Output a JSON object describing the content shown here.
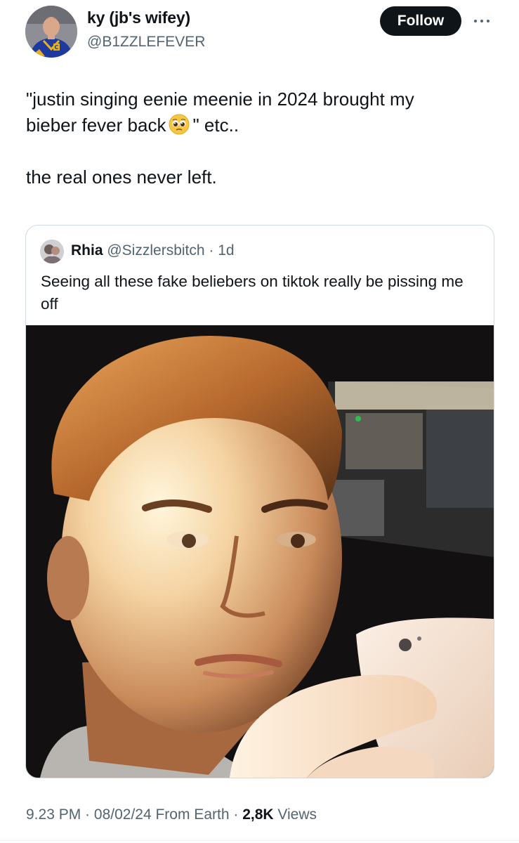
{
  "author": {
    "display_name": "ky (jb's wifey)",
    "handle": "@B1ZZLEFEVER",
    "avatar_icon": "user-avatar-icon"
  },
  "header": {
    "follow_label": "Follow",
    "more_icon": "more-options-icon"
  },
  "tweet": {
    "line1": "\"justin singing eenie meenie in 2024 brought my",
    "line2_before_emoji": "bieber fever back",
    "emoji": "pleading-face-emoji",
    "line2_after_emoji": "\" etc..",
    "line3": "the real ones never left."
  },
  "quote": {
    "name": "Rhia",
    "handle": "@Sizzlersbitch",
    "separator": " · ",
    "time": "1d",
    "text": "Seeing all these fake beliebers on tiktok really be pissing me off",
    "photo_icon": "selfie-photo"
  },
  "footer": {
    "time": "9.23 PM",
    "separator": " · ",
    "date": "08/02/24",
    "source": "From Earth",
    "views_count": "2,8K",
    "views_label": "Views"
  },
  "colors": {
    "text": "#0f1419",
    "secondary": "#536471",
    "border": "#cfd9de",
    "button": "#0f1419"
  }
}
